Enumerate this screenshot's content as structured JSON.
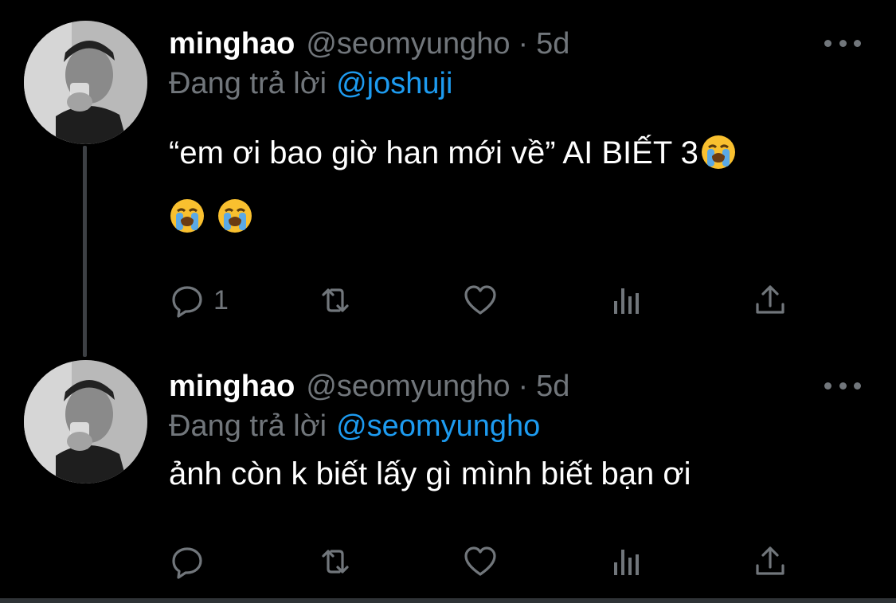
{
  "tweets": [
    {
      "display_name": "minghao",
      "handle": "@seomyungho",
      "separator": "·",
      "time": "5d",
      "reply_prefix": "Đang trả lời",
      "reply_to": "@joshuji",
      "text_line1": "“em ơi bao giờ han mới về” AI BIẾT 3",
      "text_line2": "",
      "reply_count": "1",
      "icons": [
        "more-icon",
        "reply-icon",
        "retweet-icon",
        "like-icon",
        "views-icon",
        "share-icon"
      ]
    },
    {
      "display_name": "minghao",
      "handle": "@seomyungho",
      "separator": "·",
      "time": "5d",
      "reply_prefix": "Đang trả lời",
      "reply_to": "@seomyungho",
      "text": "ảnh còn k biết lấy gì mình biết bạn ơi",
      "reply_count": "",
      "icons": [
        "more-icon",
        "reply-icon",
        "retweet-icon",
        "like-icon",
        "views-icon",
        "share-icon"
      ]
    }
  ],
  "colors": {
    "background": "#000000",
    "text": "#ffffff",
    "secondary": "#71767b",
    "link": "#1d9bf0",
    "thread_line": "#3d4044"
  }
}
